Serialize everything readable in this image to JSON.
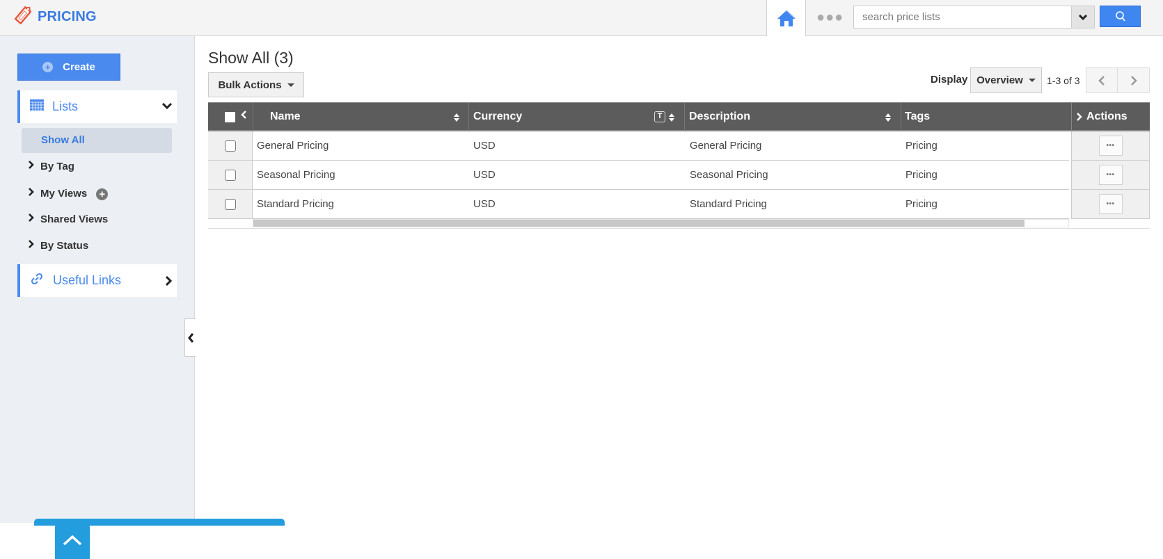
{
  "header": {
    "app_title": "PRICING",
    "search": {
      "placeholder": "search price lists",
      "value": ""
    }
  },
  "sidebar": {
    "create_label": "Create",
    "lists_label": "Lists",
    "show_all_label": "Show All",
    "nav_items": [
      {
        "label": "By Tag"
      },
      {
        "label": "My Views"
      },
      {
        "label": "Shared Views"
      },
      {
        "label": "By Status"
      }
    ],
    "useful_links_label": "Useful Links"
  },
  "main": {
    "page_title": "Show All (3)",
    "bulk_actions_label": "Bulk Actions",
    "display_label": "Display",
    "display_selected": "Overview",
    "page_count": "1-3 of 3",
    "columns": [
      "Name",
      "Currency",
      "Description",
      "Tags",
      "Actions"
    ],
    "rows": [
      {
        "name": "General Pricing",
        "currency": "USD",
        "description": "General Pricing",
        "tags": "Pricing"
      },
      {
        "name": "Seasonal Pricing",
        "currency": "USD",
        "description": "Seasonal Pricing",
        "tags": "Pricing"
      },
      {
        "name": "Standard Pricing",
        "currency": "USD",
        "description": "Standard Pricing",
        "tags": "Pricing"
      }
    ],
    "row_action_label": "•••"
  },
  "colors": {
    "accent": "#4a89ee",
    "brand": "#3a7be0",
    "table_header": "#5c5c5c",
    "help_tab": "#239ddd",
    "tag_icon": "#e8573f"
  }
}
